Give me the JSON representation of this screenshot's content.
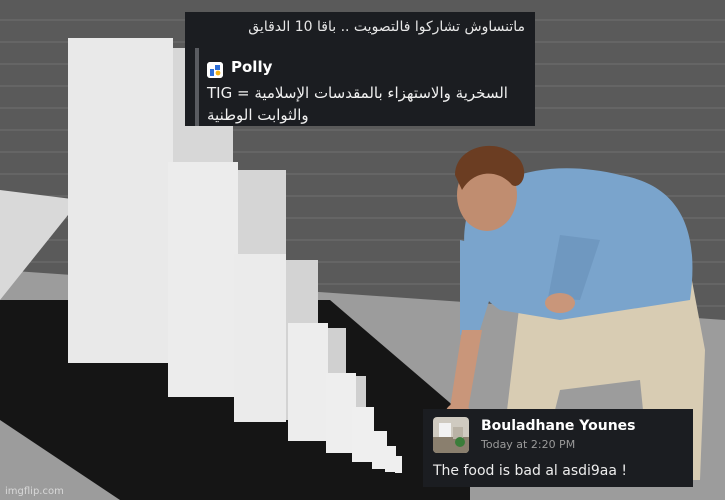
{
  "top_message": {
    "header": "ماتنساوش تشاركوا فالتصويت .. باقا 10 الدقايق",
    "app_name": "Polly",
    "line_prefix": "TIG =",
    "line1": "السخرية والاستهزاء بالمقدسات الإسلامية",
    "line2": "والثوابت الوطنية"
  },
  "bottom_message": {
    "name": "Bouladhane Younes",
    "time": "Today at 2:20 PM",
    "text": "The food is bad al asdi9aa !"
  },
  "watermark": "imgflip.com",
  "colors": {
    "card_bg": "#1b1d21",
    "polly_blue": "#2f6fd8",
    "polly_yellow": "#f5b41a"
  }
}
